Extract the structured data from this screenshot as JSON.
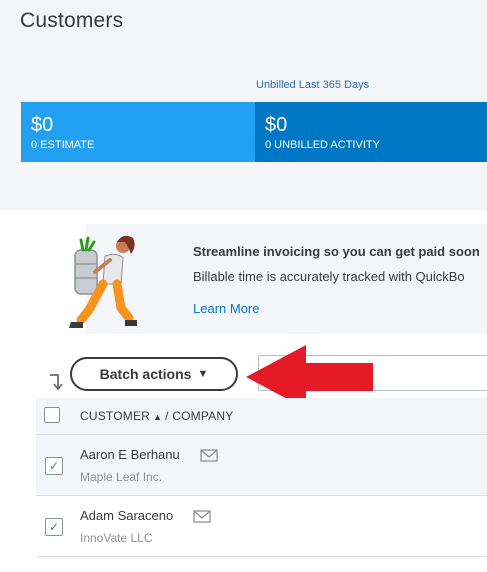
{
  "page": {
    "title": "Customers"
  },
  "money_bar": {
    "caption": "Unbilled Last 365 Days",
    "estimate": {
      "amount": "$0",
      "label": "0 ESTIMATE"
    },
    "unbilled": {
      "amount": "$0",
      "label": "0 UNBILLED ACTIVITY"
    },
    "colors": {
      "estimate": "#21a1f0",
      "unbilled": "#0077c5"
    }
  },
  "promo": {
    "headline": "Streamline invoicing so you can get paid soon",
    "body": "Billable time is accurately tracked with QuickBo",
    "link": "Learn More"
  },
  "toolbar": {
    "batch_actions": "Batch actions",
    "sort_icon": "sort-down-arrow-icon",
    "annotation_color": "#e61926"
  },
  "table": {
    "header": {
      "customer": "CUSTOMER",
      "company": "/ COMPANY"
    },
    "rows": [
      {
        "name": "Aaron E Berhanu",
        "company": "Maple Leaf Inc.",
        "checked": true
      },
      {
        "name": "Adam Saraceno",
        "company": "InnoVate LLC",
        "checked": true
      }
    ]
  }
}
